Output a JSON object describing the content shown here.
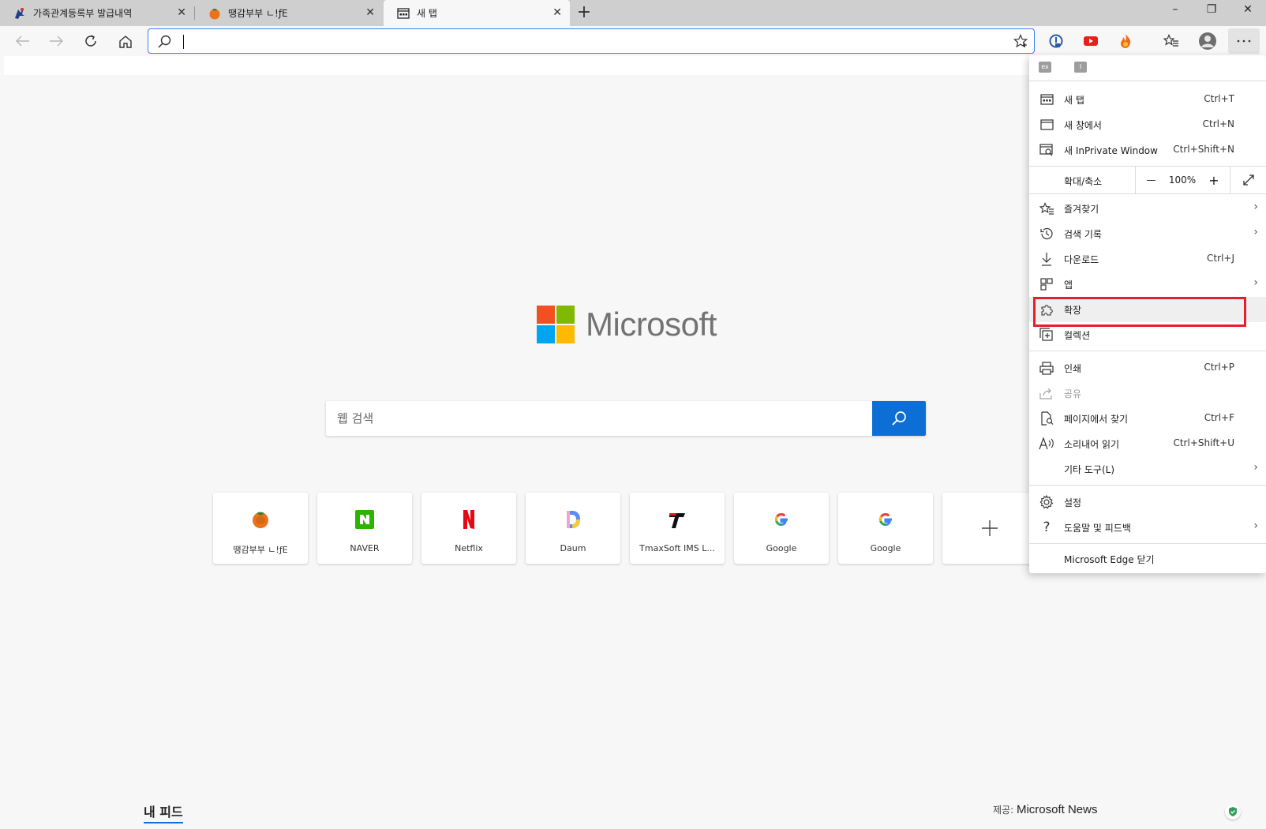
{
  "tabs": [
    {
      "title": "가족관계등록부 발급내역",
      "icon": "eagle-icon"
    },
    {
      "title": "땡감부부 ㄴ!ƒE",
      "icon": "persimmon-icon"
    },
    {
      "title": "새 탭",
      "icon": "new-tab-page-icon"
    }
  ],
  "window_controls": {
    "minimize": "–",
    "maximize": "❐",
    "close": "✕"
  },
  "address": {
    "value": "",
    "placeholder": ""
  },
  "extensions": [
    "onenote-icon",
    "youtube-icon",
    "fire-icon"
  ],
  "logo": {
    "text": "Microsoft",
    "colors": [
      "#f25022",
      "#7fba00",
      "#00a4ef",
      "#ffb900"
    ]
  },
  "search": {
    "placeholder": "웹 검색"
  },
  "quick_links": [
    {
      "label": "땡감부부 ㄴ!ƒE",
      "icon": "persimmon-icon"
    },
    {
      "label": "NAVER",
      "icon": "naver-icon"
    },
    {
      "label": "Netflix",
      "icon": "netflix-icon"
    },
    {
      "label": "Daum",
      "icon": "daum-icon"
    },
    {
      "label": "TmaxSoft IMS L...",
      "icon": "tmax-icon"
    },
    {
      "label": "Google",
      "icon": "google-icon"
    },
    {
      "label": "Google",
      "icon": "google-icon"
    },
    {
      "label": "",
      "icon": "plus-icon"
    }
  ],
  "feed": {
    "label": "내 피드",
    "provider_prefix": "제공:",
    "provider": "Microsoft News"
  },
  "menu": {
    "items": [
      {
        "label": "새 탭",
        "shortcut": "Ctrl+T",
        "icon": "new-tab-icon"
      },
      {
        "label": "새 창에서",
        "shortcut": "Ctrl+N",
        "icon": "new-window-icon"
      },
      {
        "label": "새 InPrivate Window",
        "shortcut": "Ctrl+Shift+N",
        "icon": "inprivate-icon"
      },
      {
        "label": "즐겨찾기",
        "shortcut": "",
        "icon": "favorites-icon"
      },
      {
        "label": "검색 기록",
        "shortcut": "",
        "icon": "history-icon"
      },
      {
        "label": "다운로드",
        "shortcut": "Ctrl+J",
        "icon": "download-icon"
      },
      {
        "label": "앱",
        "shortcut": "",
        "icon": "apps-icon"
      },
      {
        "label": "확장",
        "shortcut": "",
        "icon": "extensions-icon"
      },
      {
        "label": "컬렉션",
        "shortcut": "",
        "icon": "collections-icon"
      },
      {
        "label": "인쇄",
        "shortcut": "Ctrl+P",
        "icon": "print-icon"
      },
      {
        "label": "공유",
        "shortcut": "",
        "icon": "share-icon"
      },
      {
        "label": "페이지에서 찾기",
        "shortcut": "Ctrl+F",
        "icon": "find-icon"
      },
      {
        "label": "소리내어 읽기",
        "shortcut": "Ctrl+Shift+U",
        "icon": "read-aloud-icon"
      },
      {
        "label": "기타 도구(L)",
        "shortcut": "",
        "icon": ""
      },
      {
        "label": "설정",
        "shortcut": "",
        "icon": "settings-icon"
      },
      {
        "label": "도움말 및 피드백",
        "shortcut": "",
        "icon": "help-icon"
      },
      {
        "label": "Microsoft Edge 닫기",
        "shortcut": "",
        "icon": ""
      }
    ],
    "zoom": {
      "label": "확대/축소",
      "minus": "—",
      "value": "100%",
      "plus": "+"
    },
    "highlight_color": "#e3202b"
  },
  "accent": "#0d6fd6"
}
